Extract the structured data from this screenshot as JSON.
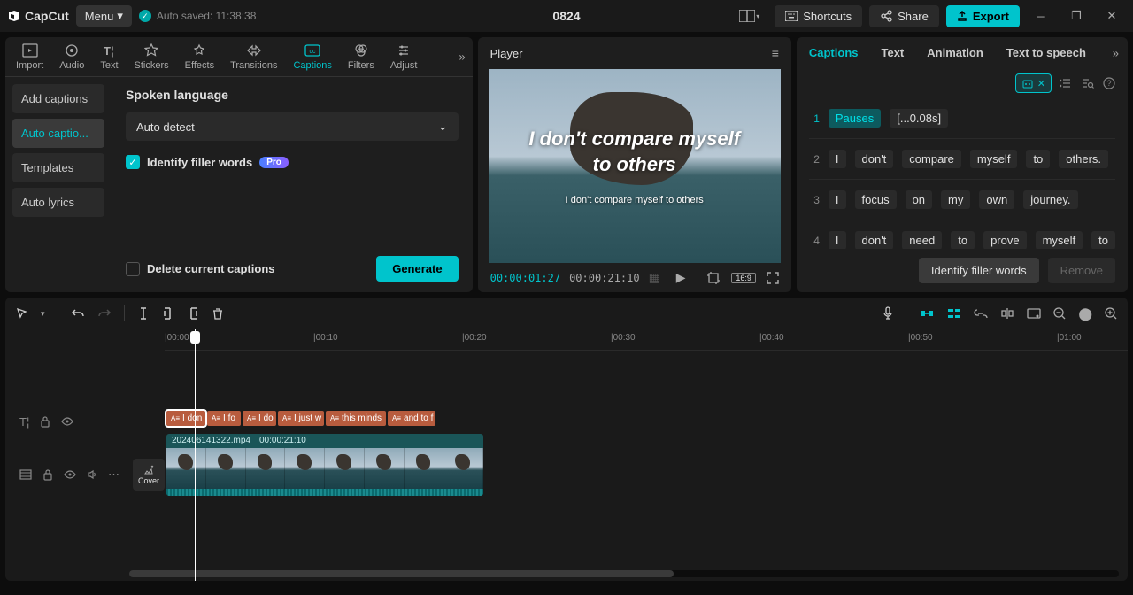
{
  "titlebar": {
    "app_name": "CapCut",
    "menu_label": "Menu",
    "autosave_label": "Auto saved: 11:38:38",
    "project_title": "0824",
    "shortcuts": "Shortcuts",
    "share": "Share",
    "export": "Export"
  },
  "tool_tabs": [
    {
      "label": "Import",
      "icon": "import"
    },
    {
      "label": "Audio",
      "icon": "audio"
    },
    {
      "label": "Text",
      "icon": "text"
    },
    {
      "label": "Stickers",
      "icon": "stickers"
    },
    {
      "label": "Effects",
      "icon": "effects"
    },
    {
      "label": "Transitions",
      "icon": "transitions"
    },
    {
      "label": "Captions",
      "icon": "captions",
      "active": true
    },
    {
      "label": "Filters",
      "icon": "filters"
    },
    {
      "label": "Adjust",
      "icon": "adjust"
    }
  ],
  "captions_sidebar": [
    {
      "label": "Add captions"
    },
    {
      "label": "Auto captio...",
      "active": true
    },
    {
      "label": "Templates"
    },
    {
      "label": "Auto lyrics"
    }
  ],
  "captions_panel": {
    "section_title": "Spoken language",
    "language_value": "Auto detect",
    "identify_filler": "Identify filler words",
    "pro": "Pro",
    "delete_current": "Delete current captions",
    "generate": "Generate"
  },
  "player": {
    "title": "Player",
    "caption_line1": "I don't compare myself",
    "caption_line2": "to others",
    "caption_sub": "I don't compare myself to others",
    "time_current": "00:00:01:27",
    "time_total": "00:00:21:10",
    "ratio": "16:9"
  },
  "right_tabs": [
    "Captions",
    "Text",
    "Animation",
    "Text to speech"
  ],
  "caption_rows": [
    {
      "n": "1",
      "words": [
        "Pauses",
        "[...0.08s]"
      ],
      "first_highlight": true
    },
    {
      "n": "2",
      "words": [
        "I",
        "don't",
        "compare",
        "myself",
        "to",
        "others."
      ]
    },
    {
      "n": "3",
      "words": [
        "I",
        "focus",
        "on",
        "my",
        "own",
        "journey."
      ]
    },
    {
      "n": "4",
      "words": [
        "I",
        "don't",
        "need",
        "to",
        "prove",
        "myself",
        "to"
      ]
    }
  ],
  "right_footer": {
    "identify": "Identify filler words",
    "remove": "Remove"
  },
  "ruler": [
    "|00:00",
    "|00:10",
    "|00:20",
    "|00:30",
    "|00:40",
    "|00:50",
    "|01:00"
  ],
  "timeline": {
    "cover": "Cover",
    "caption_clips": [
      "I don",
      "I fo",
      "I do",
      "I just w",
      "this minds",
      "and to f"
    ],
    "video_name": "202406141322.mp4",
    "video_duration": "00:00:21:10"
  }
}
